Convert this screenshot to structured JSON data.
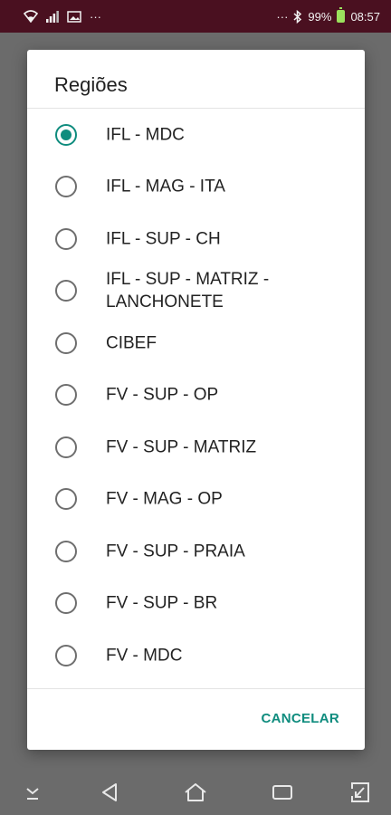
{
  "status_bar": {
    "dots_left": "···",
    "dots_right": "···",
    "battery_percent": "99%",
    "time": "08:57"
  },
  "dialog": {
    "title": "Regiões",
    "options": [
      {
        "label": "IFL - MDC",
        "checked": true
      },
      {
        "label": "IFL - MAG - ITA",
        "checked": false
      },
      {
        "label": "IFL - SUP - CH",
        "checked": false
      },
      {
        "label": "IFL - SUP - MATRIZ - LANCHONETE",
        "checked": false
      },
      {
        "label": "CIBEF",
        "checked": false
      },
      {
        "label": "FV - SUP - OP",
        "checked": false
      },
      {
        "label": "FV - SUP - MATRIZ",
        "checked": false
      },
      {
        "label": "FV - MAG - OP",
        "checked": false
      },
      {
        "label": "FV - SUP - PRAIA",
        "checked": false
      },
      {
        "label": "FV - SUP - BR",
        "checked": false
      },
      {
        "label": "FV - MDC",
        "checked": false
      }
    ],
    "cancel_label": "CANCELAR"
  },
  "nav_bar": {
    "icons": [
      "chevron-down-icon",
      "back-icon",
      "home-icon",
      "recents-icon",
      "screenshot-icon"
    ]
  },
  "colors": {
    "accent": "#0f8c7e",
    "status_bar": "#4a1020",
    "scrim": "#6b6b6b"
  }
}
